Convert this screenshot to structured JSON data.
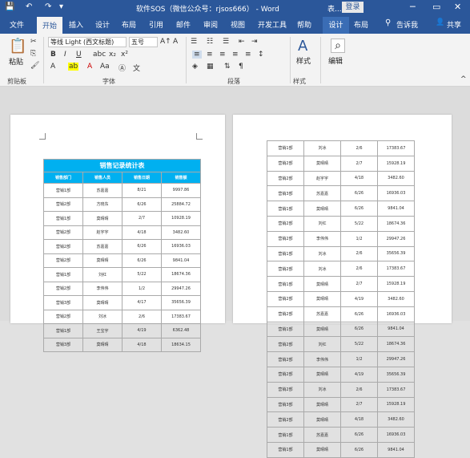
{
  "titlebar": {
    "title": "软件SOS（微信公众号：rjsos666） - Word",
    "account": "表...",
    "login": "登录",
    "min_icon": "─",
    "restore_icon": "▭",
    "close_icon": "✕",
    "quick_access": [
      "save-icon",
      "undo-icon",
      "redo-icon",
      "customize-icon"
    ]
  },
  "tabs": [
    "文件",
    "开始",
    "插入",
    "设计",
    "布局",
    "引用",
    "邮件",
    "审阅",
    "视图",
    "开发工具",
    "帮助",
    "设计",
    "布局"
  ],
  "tell_me": "告诉我",
  "share": "共享",
  "ribbon": {
    "clipboard": {
      "paste": "粘贴",
      "label": "剪贴板"
    },
    "font": {
      "name": "等线 Light (西文标题)",
      "size": "五号",
      "label": "字体"
    },
    "paragraph": {
      "label": "段落"
    },
    "styles": {
      "button": "样式",
      "label": "样式"
    },
    "editing": {
      "button": "编辑"
    }
  },
  "table1": {
    "title": "销售记录统计表",
    "headers": [
      "销售部门",
      "销售人员",
      "销售日期",
      "销售额"
    ],
    "rows": [
      [
        "营销1部",
        "苏嘉嘉",
        "8/21",
        "9997.86"
      ],
      [
        "营销2部",
        "方晓东",
        "6/26",
        "25884.72"
      ],
      [
        "营销1部",
        "莫晴晴",
        "2/7",
        "10928.19"
      ],
      [
        "营销2部",
        "赵宇宇",
        "4/18",
        "3482.60"
      ],
      [
        "营销2部",
        "苏嘉嘉",
        "6/26",
        "16936.03"
      ],
      [
        "营销2部",
        "莫晴晴",
        "6/26",
        "9841.04"
      ],
      [
        "营销1部",
        "刘红",
        "5/22",
        "18674.36"
      ],
      [
        "营销2部",
        "李伟伟",
        "1/2",
        "29947.26"
      ],
      [
        "营销3部",
        "莫晴晴",
        "4/17",
        "35656.39"
      ],
      [
        "营销2部",
        "刘冰",
        "2/6",
        "17383.67"
      ],
      [
        "营销1部",
        "王宝宇",
        "4/19",
        "6362.48"
      ],
      [
        "营销3部",
        "莫晴晴",
        "4/18",
        "18634.15"
      ]
    ]
  },
  "table2": {
    "rows": [
      [
        "营销1部",
        "刘冰",
        "2/6",
        "17383.67"
      ],
      [
        "营销2部",
        "莫晴晴",
        "2/7",
        "15928.19"
      ],
      [
        "营销2部",
        "赵宇宇",
        "4/18",
        "3482.60"
      ],
      [
        "营销3部",
        "苏嘉嘉",
        "6/26",
        "16936.03"
      ],
      [
        "营销1部",
        "莫晴晴",
        "6/26",
        "9841.04"
      ],
      [
        "营销2部",
        "刘红",
        "5/22",
        "18674.36"
      ],
      [
        "营销2部",
        "李伟伟",
        "1/2",
        "29947.26"
      ],
      [
        "营销1部",
        "刘冰",
        "2/6",
        "35656.39"
      ],
      [
        "营销2部",
        "刘冰",
        "2/6",
        "17383.67"
      ],
      [
        "营销1部",
        "莫晴晴",
        "2/7",
        "15928.19"
      ],
      [
        "营销2部",
        "莫晴晴",
        "4/19",
        "3482.60"
      ],
      [
        "营销2部",
        "苏嘉嘉",
        "6/26",
        "16936.03"
      ],
      [
        "营销1部",
        "莫晴晴",
        "6/26",
        "9841.04"
      ],
      [
        "营销2部",
        "刘红",
        "5/22",
        "18674.36"
      ],
      [
        "营销2部",
        "李伟伟",
        "1/2",
        "29947.26"
      ],
      [
        "营销2部",
        "莫晴晴",
        "4/19",
        "35656.39"
      ],
      [
        "营销2部",
        "刘冰",
        "2/6",
        "17383.67"
      ],
      [
        "营销3部",
        "莫晴晴",
        "2/7",
        "15928.19"
      ],
      [
        "营销2部",
        "莫晴晴",
        "4/18",
        "3482.60"
      ],
      [
        "营销1部",
        "苏嘉嘉",
        "6/26",
        "16936.03"
      ],
      [
        "营销1部",
        "莫晴晴",
        "6/26",
        "9841.04"
      ]
    ]
  },
  "colors": {
    "brand": "#2b579a",
    "table_header": "#00b0f0"
  }
}
